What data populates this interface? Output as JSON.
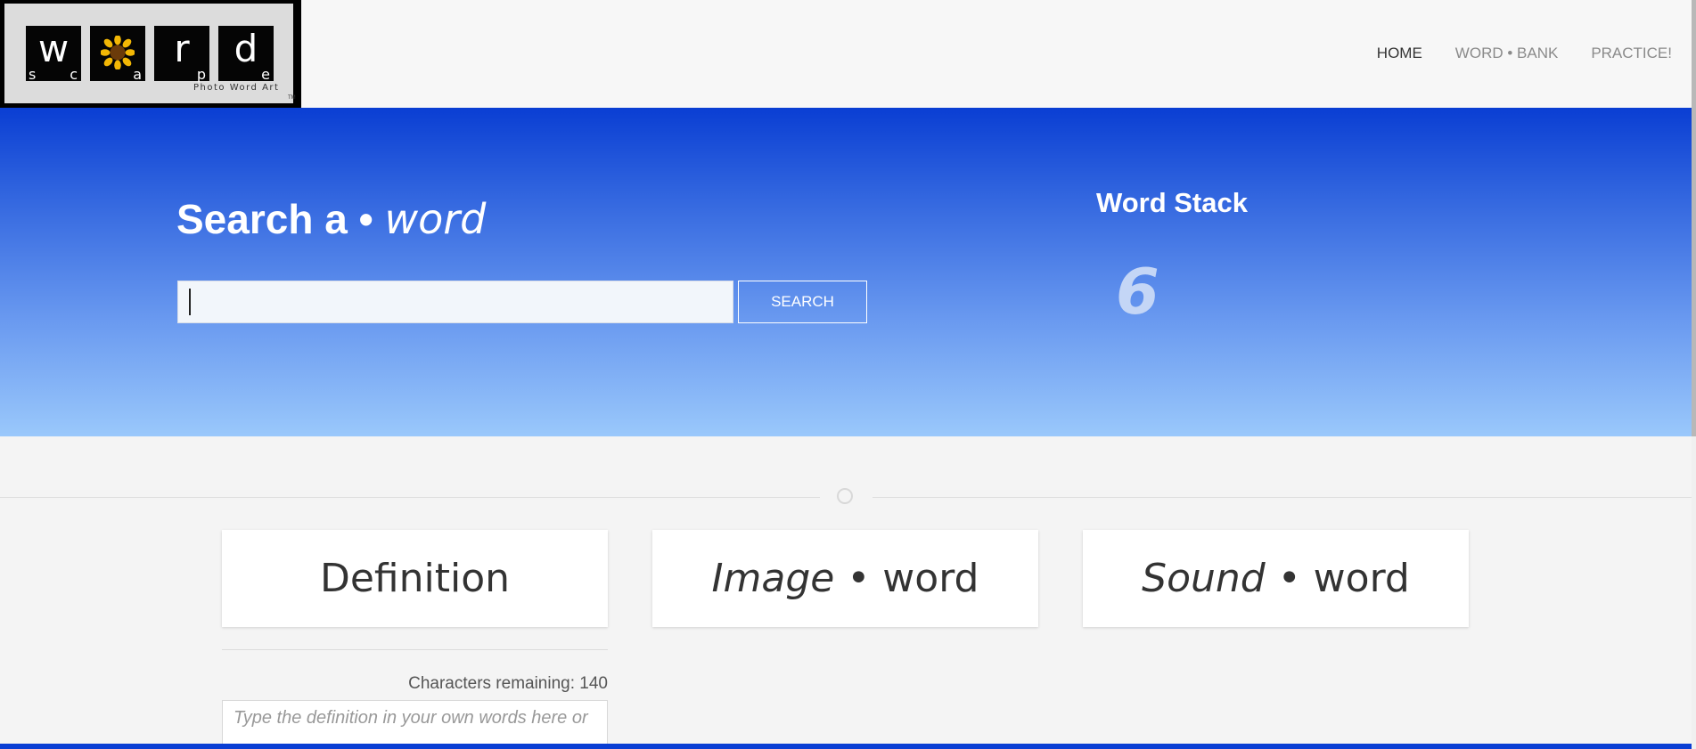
{
  "logo": {
    "tiles": [
      {
        "big": "w",
        "small_left": "s",
        "small_right": "c"
      },
      {
        "big": "",
        "small_left": "",
        "small_right": "a"
      },
      {
        "big": "r",
        "small_left": "",
        "small_right": "p"
      },
      {
        "big": "d",
        "small_left": "",
        "small_right": "e"
      }
    ],
    "tagline": "Photo Word Art",
    "tm": "TM"
  },
  "nav": {
    "items": [
      {
        "label": "HOME",
        "active": true
      },
      {
        "label": "WORD • BANK",
        "active": false
      },
      {
        "label": "PRACTICE!",
        "active": false
      }
    ]
  },
  "hero": {
    "title_bold": "Search a • ",
    "title_italic": "word",
    "search_value": "",
    "search_button": "SEARCH",
    "stack_title": "Word Stack",
    "stack_count": "6"
  },
  "cards": {
    "definition": "Definition",
    "image_italic": "Image",
    "image_rest": " • word",
    "sound_italic": "Sound",
    "sound_rest": " • word"
  },
  "definition_panel": {
    "chars_label": "Characters remaining:",
    "chars_value": "140",
    "placeholder": "Type the definition in your own words here or"
  },
  "colors": {
    "hero_top": "#0a3ed3",
    "hero_bottom": "#9ac8fb",
    "nav_active": "#333333",
    "nav_inactive": "#8a8a8a"
  }
}
